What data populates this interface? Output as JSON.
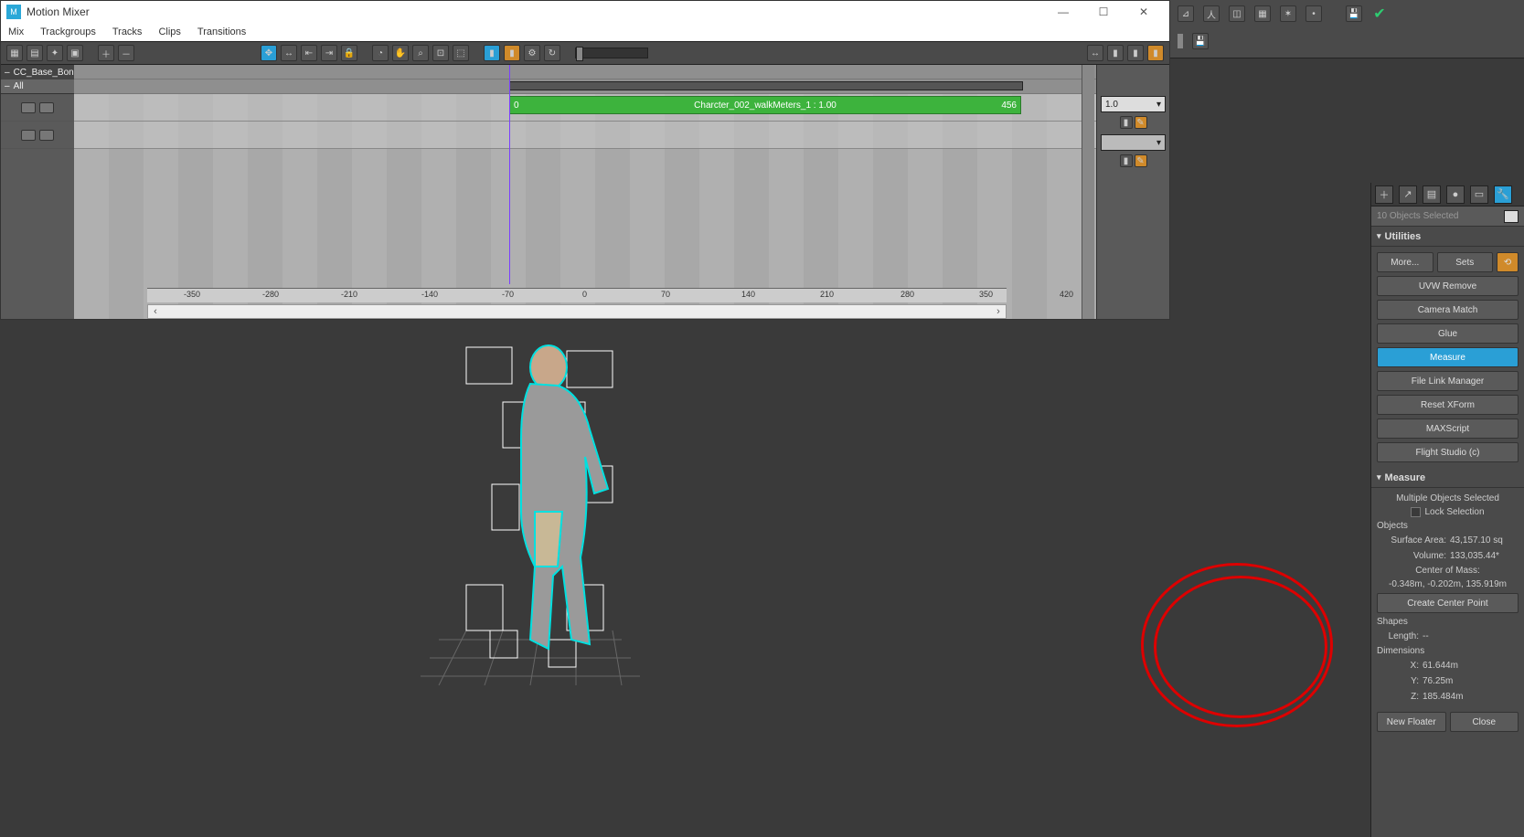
{
  "window": {
    "title": "Motion Mixer",
    "min": "—",
    "max": "☐",
    "close": "✕"
  },
  "menubar": [
    "Mix",
    "Trackgroups",
    "Tracks",
    "Clips",
    "Transitions"
  ],
  "trackgroup": {
    "name": "CC_Base_BoneR",
    "sub": "All"
  },
  "clip": {
    "label": "Charcter_002_walkMeters_1 : 1.00",
    "start": "0",
    "end": "456"
  },
  "ruler": {
    "ticks": [
      {
        "label": "-350",
        "pos": 40
      },
      {
        "label": "-280",
        "pos": 126
      },
      {
        "label": "-210",
        "pos": 212
      },
      {
        "label": "-140",
        "pos": 300
      },
      {
        "label": "-70",
        "pos": 388
      },
      {
        "label": "0",
        "pos": 476
      },
      {
        "label": "70",
        "pos": 562
      },
      {
        "label": "140",
        "pos": 650
      },
      {
        "label": "210",
        "pos": 736
      },
      {
        "label": "280",
        "pos": 824
      },
      {
        "label": "350",
        "pos": 910
      },
      {
        "label": "420",
        "pos": 998
      }
    ]
  },
  "scale": "1.0",
  "selection_label": "10 Objects Selected",
  "utilities": {
    "header": "Utilities",
    "more": "More...",
    "sets": "Sets",
    "buttons": [
      "UVW Remove",
      "Camera Match",
      "Glue",
      "Measure",
      "File Link Manager",
      "Reset XForm",
      "MAXScript",
      "Flight Studio (c)"
    ]
  },
  "measure": {
    "header": "Measure",
    "status": "Multiple Objects Selected",
    "lock": "Lock Selection",
    "objects_label": "Objects",
    "surface_k": "Surface Area:",
    "surface_v": "43,157.10 sq",
    "volume_k": "Volume:",
    "volume_v": "133,035.44*",
    "com_label": "Center of Mass:",
    "com_value": "-0.348m, -0.202m, 135.919m",
    "create_center": "Create Center Point",
    "shapes_label": "Shapes",
    "length_k": "Length:",
    "length_v": "--",
    "dims_label": "Dimensions",
    "dim_x_k": "X:",
    "dim_x_v": "61.644m",
    "dim_y_k": "Y:",
    "dim_y_v": "76.25m",
    "dim_z_k": "Z:",
    "dim_z_v": "185.484m",
    "new_floater": "New Floater",
    "close": "Close"
  }
}
